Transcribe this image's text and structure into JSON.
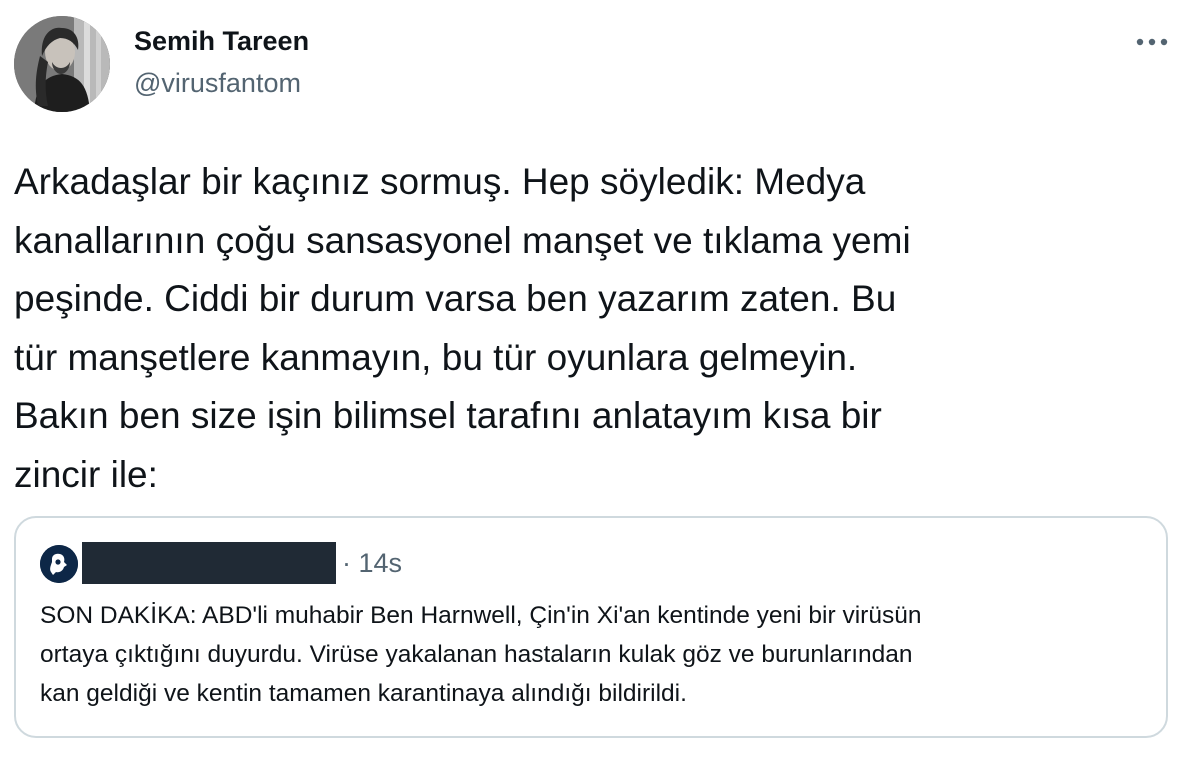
{
  "author": {
    "display_name": "Semih Tareen",
    "handle": "@virusfantom",
    "avatar_icon": "user-photo-avatar"
  },
  "tweet": {
    "text": "Arkadaşlar bir kaçınız sormuş. Hep söyledik: Medya\nkanallarının çoğu sansasyonel manşet ve tıklama yemi\npeşinde. Ciddi bir durum varsa ben yazarım zaten. Bu\ntür manşetlere kanmayın, bu tür oyunlara gelmeyin.\nBakın ben size işin bilimsel tarafını anlatayım kısa bir\nzincir ile:"
  },
  "menu": {
    "more_icon": "more-options-icon"
  },
  "quote": {
    "avatar_icon": "account-avatar-icon",
    "author_redacted": true,
    "time": "· 14s",
    "text": "SON DAKİKA: ABD'li muhabir Ben Harnwell, Çin'in Xi'an kentinde yeni bir virüsün\nortaya çıktığını duyurdu. Virüse yakalanan hastaların kulak göz ve burunlarından\nkan geldiği ve kentin tamamen karantinaya alındığı bildirildi."
  },
  "colors": {
    "text_primary": "#0f1419",
    "text_secondary": "#536471",
    "border": "#cfd9de",
    "redaction": "#202a35",
    "quote_avatar_bg": "#0d2747"
  }
}
